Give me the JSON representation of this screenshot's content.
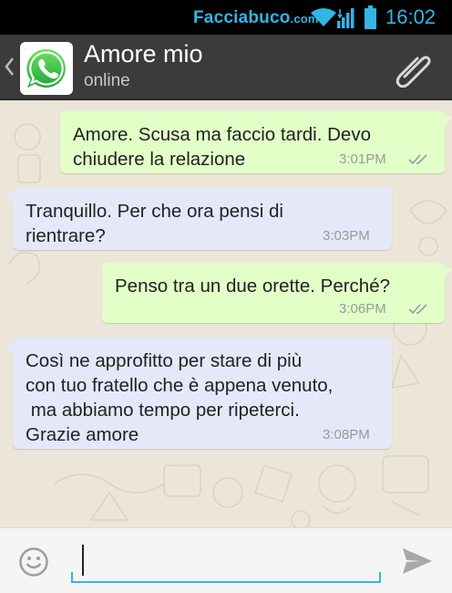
{
  "status_bar": {
    "watermark": "Facciabuco",
    "watermark_suffix": ".com",
    "time": "16:02",
    "icons": [
      "wifi-icon",
      "signal-icon",
      "battery-icon"
    ]
  },
  "header": {
    "contact_name": "Amore mio",
    "contact_status": "online",
    "icons": [
      "back-chevron-icon",
      "whatsapp-logo",
      "attach-icon"
    ]
  },
  "messages": [
    {
      "direction": "outgoing",
      "text": "Amore. Scusa ma faccio tardi. Devo\nchiudere la relazione",
      "time": "3:01PM",
      "read": true
    },
    {
      "direction": "incoming",
      "text": "Tranquillo. Per che ora pensi di\nrientrare?",
      "time": "3:03PM"
    },
    {
      "direction": "outgoing",
      "text": "Penso tra un due orette. Perché?",
      "time": "3:06PM",
      "read": true
    },
    {
      "direction": "incoming",
      "text": "Così ne approfitto per stare di più\ncon tuo fratello che è appena venuto,\n ma abbiamo tempo per ripeterci.\nGrazie amore",
      "time": "3:08PM"
    }
  ],
  "composer": {
    "value": "",
    "placeholder": "",
    "icons": [
      "emoji-icon",
      "send-icon"
    ]
  },
  "colors": {
    "accent": "#33b5e5",
    "action_bar": "#3b3b3b",
    "outgoing_bubble": "#e2ffc8",
    "incoming_bubble": "#e4e8f8",
    "wallpaper": "#ece6d8"
  }
}
